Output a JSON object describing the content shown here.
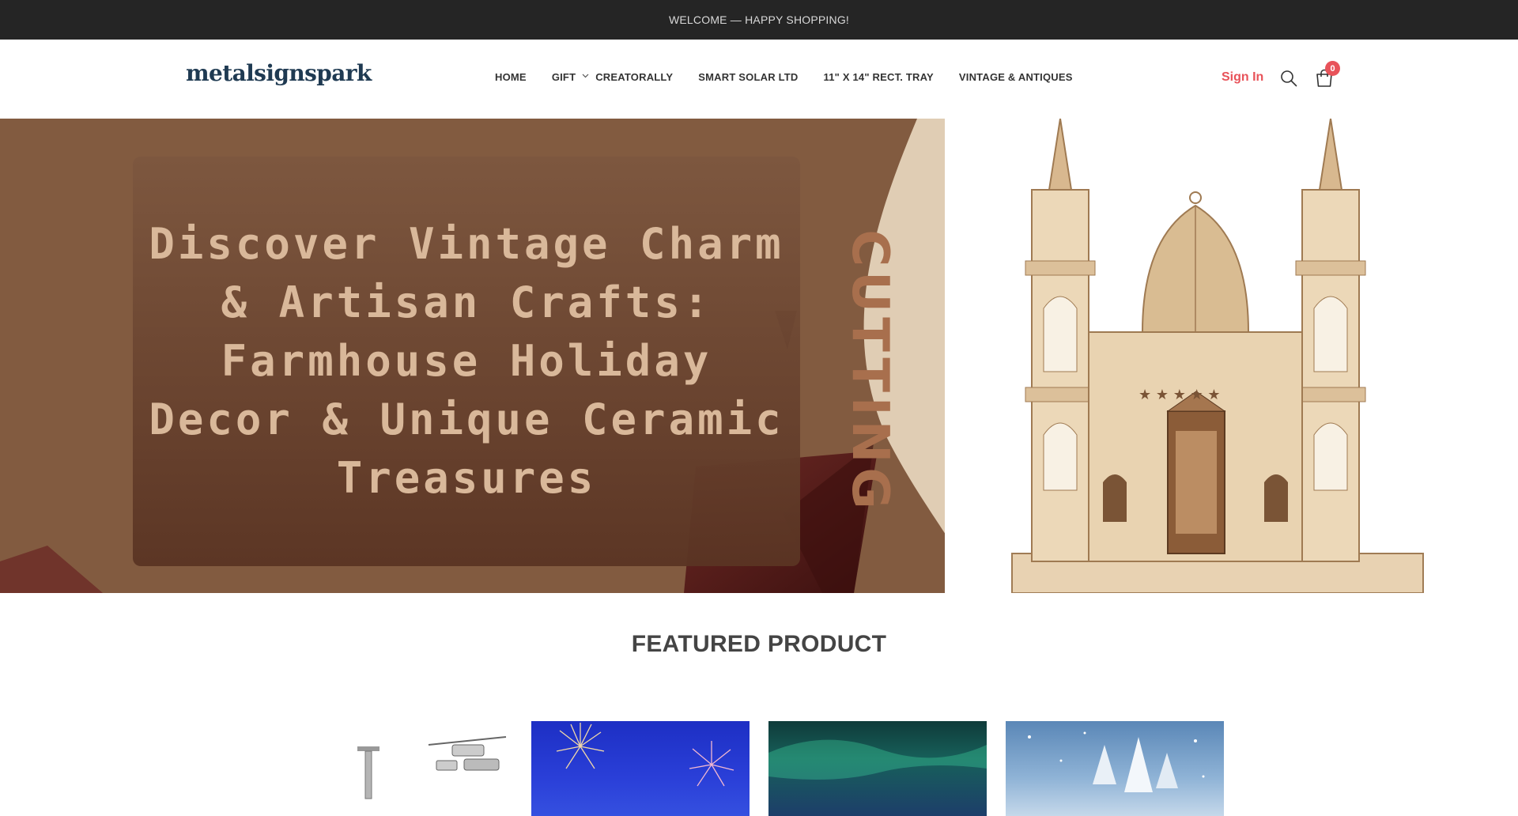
{
  "announcement": "WELCOME — HAPPY SHOPPING!",
  "logo": "metalsignspark",
  "nav": {
    "items": [
      {
        "label": "HOME"
      },
      {
        "label": "GIFT"
      },
      {
        "label": "CREATORALLY"
      },
      {
        "label": "SMART SOLAR LTD"
      },
      {
        "label": "11\" X 14\" RECT. TRAY"
      },
      {
        "label": "VINTAGE & ANTIQUES"
      }
    ]
  },
  "account": {
    "sign_in": "Sign In",
    "cart_count": "0"
  },
  "hero": {
    "headline": "Discover Vintage Charm & Artisan Crafts: Farmhouse Holiday Decor & Unique Ceramic Treasures",
    "side_text": "CUTTING"
  },
  "featured": {
    "title": "FEATURED PRODUCT"
  },
  "colors": {
    "topbar_bg": "#252525",
    "accent": "#e8535a",
    "hero_brown": "#7f573e",
    "hero_text": "#d9b89a"
  },
  "icons": [
    "chevron-down-icon",
    "search-icon",
    "cart-icon"
  ]
}
